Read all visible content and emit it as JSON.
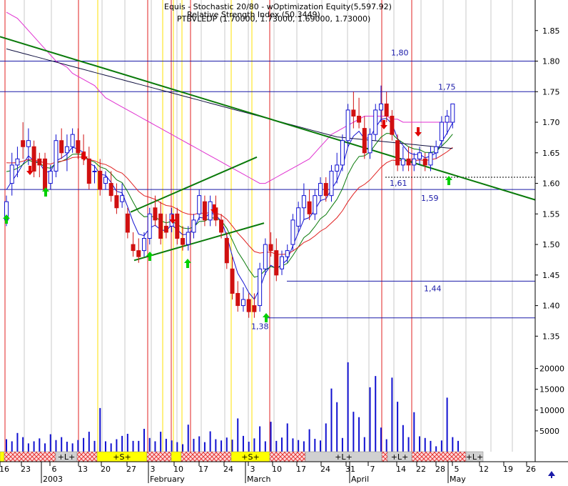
{
  "header": {
    "line1": "Equis - Stochastic 20/80 - wOptimization Equity(5,597.92)",
    "line2": "Relative Strength Index (50.3449)",
    "line3": "PTBVLEDP (1.70000, 1.73000, 1.69000, 1.73000)"
  },
  "chart_data": {
    "type": "candlestick",
    "ylim": [
      1.32,
      1.9
    ],
    "price_ticks": [
      1.35,
      1.4,
      1.45,
      1.5,
      1.55,
      1.6,
      1.65,
      1.7,
      1.75,
      1.8,
      1.85
    ],
    "price_tick_labels": [
      "1.35",
      "1.40",
      "1.45",
      "1.50",
      "1.55",
      "1.60",
      "1.65",
      "1.70",
      "1.75",
      "1.80",
      "1.85"
    ],
    "volume_ylim": [
      0,
      22000
    ],
    "volume_ticks": [
      5000,
      10000,
      15000,
      20000
    ],
    "volume_tick_labels": [
      "5000",
      "10000",
      "15000",
      "20000"
    ],
    "date_labels": [
      "16",
      "23",
      "6",
      "13",
      "20",
      "27",
      "3",
      "10",
      "17",
      "24",
      "3",
      "10",
      "17",
      "24",
      "31",
      "7",
      "14",
      "22",
      "28",
      "5",
      "12",
      "19",
      "26"
    ],
    "month_labels": [
      "2003",
      "February",
      "March",
      "April",
      "May"
    ],
    "horizontal_levels": [
      {
        "value": 1.8,
        "label": "1,80"
      },
      {
        "value": 1.75,
        "label": "1,75"
      },
      {
        "value": 1.59,
        "label": "1,59"
      },
      {
        "value": 1.44,
        "label": "1,44"
      },
      {
        "value": 1.38,
        "label": "1,38"
      }
    ],
    "dotted_level": {
      "value": 1.61,
      "label": "1,61"
    },
    "candles": [
      {
        "o": 1.54,
        "h": 1.58,
        "l": 1.53,
        "c": 1.57
      },
      {
        "o": 1.6,
        "h": 1.65,
        "l": 1.58,
        "c": 1.63
      },
      {
        "o": 1.63,
        "h": 1.66,
        "l": 1.61,
        "c": 1.64
      },
      {
        "o": 1.67,
        "h": 1.7,
        "l": 1.64,
        "c": 1.66
      },
      {
        "o": 1.66,
        "h": 1.69,
        "l": 1.63,
        "c": 1.67
      },
      {
        "o": 1.66,
        "h": 1.67,
        "l": 1.61,
        "c": 1.62
      },
      {
        "o": 1.64,
        "h": 1.65,
        "l": 1.61,
        "c": 1.63
      },
      {
        "o": 1.64,
        "h": 1.65,
        "l": 1.58,
        "c": 1.59
      },
      {
        "o": 1.6,
        "h": 1.63,
        "l": 1.59,
        "c": 1.62
      },
      {
        "o": 1.62,
        "h": 1.68,
        "l": 1.61,
        "c": 1.67
      },
      {
        "o": 1.67,
        "h": 1.69,
        "l": 1.64,
        "c": 1.65
      },
      {
        "o": 1.65,
        "h": 1.68,
        "l": 1.62,
        "c": 1.66
      },
      {
        "o": 1.66,
        "h": 1.69,
        "l": 1.65,
        "c": 1.68
      },
      {
        "o": 1.67,
        "h": 1.69,
        "l": 1.64,
        "c": 1.65
      },
      {
        "o": 1.65,
        "h": 1.68,
        "l": 1.63,
        "c": 1.64
      },
      {
        "o": 1.64,
        "h": 1.66,
        "l": 1.59,
        "c": 1.6
      },
      {
        "o": 1.62,
        "h": 1.63,
        "l": 1.6,
        "c": 1.62
      },
      {
        "o": 1.62,
        "h": 1.64,
        "l": 1.58,
        "c": 1.59
      },
      {
        "o": 1.6,
        "h": 1.62,
        "l": 1.59,
        "c": 1.61
      },
      {
        "o": 1.6,
        "h": 1.62,
        "l": 1.57,
        "c": 1.58
      },
      {
        "o": 1.58,
        "h": 1.6,
        "l": 1.55,
        "c": 1.56
      },
      {
        "o": 1.57,
        "h": 1.6,
        "l": 1.56,
        "c": 1.58
      },
      {
        "o": 1.55,
        "h": 1.56,
        "l": 1.51,
        "c": 1.52
      },
      {
        "o": 1.5,
        "h": 1.52,
        "l": 1.48,
        "c": 1.49
      },
      {
        "o": 1.49,
        "h": 1.51,
        "l": 1.47,
        "c": 1.48
      },
      {
        "o": 1.49,
        "h": 1.52,
        "l": 1.48,
        "c": 1.51
      },
      {
        "o": 1.51,
        "h": 1.56,
        "l": 1.5,
        "c": 1.55
      },
      {
        "o": 1.56,
        "h": 1.58,
        "l": 1.53,
        "c": 1.54
      },
      {
        "o": 1.55,
        "h": 1.57,
        "l": 1.5,
        "c": 1.51
      },
      {
        "o": 1.53,
        "h": 1.55,
        "l": 1.51,
        "c": 1.52
      },
      {
        "o": 1.53,
        "h": 1.56,
        "l": 1.52,
        "c": 1.55
      },
      {
        "o": 1.55,
        "h": 1.56,
        "l": 1.5,
        "c": 1.51
      },
      {
        "o": 1.51,
        "h": 1.53,
        "l": 1.49,
        "c": 1.5
      },
      {
        "o": 1.5,
        "h": 1.53,
        "l": 1.49,
        "c": 1.52
      },
      {
        "o": 1.52,
        "h": 1.55,
        "l": 1.51,
        "c": 1.54
      },
      {
        "o": 1.55,
        "h": 1.59,
        "l": 1.54,
        "c": 1.58
      },
      {
        "o": 1.57,
        "h": 1.58,
        "l": 1.53,
        "c": 1.54
      },
      {
        "o": 1.54,
        "h": 1.58,
        "l": 1.53,
        "c": 1.57
      },
      {
        "o": 1.56,
        "h": 1.58,
        "l": 1.53,
        "c": 1.54
      },
      {
        "o": 1.54,
        "h": 1.55,
        "l": 1.51,
        "c": 1.52
      },
      {
        "o": 1.51,
        "h": 1.52,
        "l": 1.46,
        "c": 1.47
      },
      {
        "o": 1.46,
        "h": 1.48,
        "l": 1.41,
        "c": 1.42
      },
      {
        "o": 1.42,
        "h": 1.44,
        "l": 1.39,
        "c": 1.4
      },
      {
        "o": 1.4,
        "h": 1.43,
        "l": 1.39,
        "c": 1.41
      },
      {
        "o": 1.41,
        "h": 1.42,
        "l": 1.38,
        "c": 1.39
      },
      {
        "o": 1.4,
        "h": 1.42,
        "l": 1.38,
        "c": 1.39
      },
      {
        "o": 1.4,
        "h": 1.47,
        "l": 1.39,
        "c": 1.46
      },
      {
        "o": 1.46,
        "h": 1.51,
        "l": 1.45,
        "c": 1.5
      },
      {
        "o": 1.5,
        "h": 1.52,
        "l": 1.48,
        "c": 1.49
      },
      {
        "o": 1.49,
        "h": 1.51,
        "l": 1.44,
        "c": 1.45
      },
      {
        "o": 1.46,
        "h": 1.49,
        "l": 1.45,
        "c": 1.48
      },
      {
        "o": 1.48,
        "h": 1.5,
        "l": 1.47,
        "c": 1.49
      },
      {
        "o": 1.5,
        "h": 1.55,
        "l": 1.49,
        "c": 1.54
      },
      {
        "o": 1.53,
        "h": 1.57,
        "l": 1.52,
        "c": 1.56
      },
      {
        "o": 1.56,
        "h": 1.6,
        "l": 1.54,
        "c": 1.58
      },
      {
        "o": 1.57,
        "h": 1.59,
        "l": 1.54,
        "c": 1.55
      },
      {
        "o": 1.55,
        "h": 1.59,
        "l": 1.54,
        "c": 1.58
      },
      {
        "o": 1.58,
        "h": 1.61,
        "l": 1.57,
        "c": 1.6
      },
      {
        "o": 1.6,
        "h": 1.61,
        "l": 1.57,
        "c": 1.58
      },
      {
        "o": 1.58,
        "h": 1.63,
        "l": 1.57,
        "c": 1.62
      },
      {
        "o": 1.62,
        "h": 1.65,
        "l": 1.6,
        "c": 1.63
      },
      {
        "o": 1.63,
        "h": 1.68,
        "l": 1.62,
        "c": 1.67
      },
      {
        "o": 1.67,
        "h": 1.73,
        "l": 1.66,
        "c": 1.72
      },
      {
        "o": 1.72,
        "h": 1.75,
        "l": 1.69,
        "c": 1.71
      },
      {
        "o": 1.71,
        "h": 1.74,
        "l": 1.69,
        "c": 1.7
      },
      {
        "o": 1.69,
        "h": 1.71,
        "l": 1.64,
        "c": 1.65
      },
      {
        "o": 1.65,
        "h": 1.69,
        "l": 1.64,
        "c": 1.68
      },
      {
        "o": 1.68,
        "h": 1.73,
        "l": 1.67,
        "c": 1.72
      },
      {
        "o": 1.72,
        "h": 1.76,
        "l": 1.7,
        "c": 1.73
      },
      {
        "o": 1.73,
        "h": 1.75,
        "l": 1.7,
        "c": 1.71
      },
      {
        "o": 1.71,
        "h": 1.72,
        "l": 1.67,
        "c": 1.68
      },
      {
        "o": 1.67,
        "h": 1.68,
        "l": 1.62,
        "c": 1.63
      },
      {
        "o": 1.63,
        "h": 1.66,
        "l": 1.62,
        "c": 1.64
      },
      {
        "o": 1.64,
        "h": 1.66,
        "l": 1.62,
        "c": 1.63
      },
      {
        "o": 1.63,
        "h": 1.65,
        "l": 1.62,
        "c": 1.64
      },
      {
        "o": 1.64,
        "h": 1.66,
        "l": 1.63,
        "c": 1.65
      },
      {
        "o": 1.64,
        "h": 1.65,
        "l": 1.62,
        "c": 1.63
      },
      {
        "o": 1.63,
        "h": 1.66,
        "l": 1.62,
        "c": 1.65
      },
      {
        "o": 1.65,
        "h": 1.67,
        "l": 1.64,
        "c": 1.66
      },
      {
        "o": 1.67,
        "h": 1.71,
        "l": 1.66,
        "c": 1.7
      },
      {
        "o": 1.7,
        "h": 1.72,
        "l": 1.68,
        "c": 1.71
      },
      {
        "o": 1.7,
        "h": 1.73,
        "l": 1.69,
        "c": 1.73
      }
    ],
    "volume": [
      3000,
      2500,
      4500,
      3500,
      2000,
      2500,
      3200,
      2000,
      4200,
      2800,
      3500,
      2400,
      2000,
      2800,
      3300,
      4800,
      2600,
      10500,
      2500,
      2000,
      3000,
      3800,
      4300,
      2600,
      2600,
      5500,
      3300,
      2500,
      4800,
      3100,
      2700,
      2300,
      1800,
      6500,
      3100,
      3700,
      2300,
      4900,
      3000,
      2700,
      3400,
      2900,
      8000,
      3800,
      2400,
      3200,
      6100,
      2500,
      7200,
      2600,
      3400,
      6800,
      3200,
      2800,
      2500,
      5400,
      3100,
      2700,
      6800,
      15200,
      11900,
      3300,
      21500,
      9600,
      8300,
      3500,
      15500,
      18200,
      5800,
      3000,
      17800,
      12000,
      6400,
      3500,
      9500,
      3700,
      3300,
      2600,
      1300,
      2700,
      13000,
      3500,
      2600
    ],
    "moving_average_slow": [
      1.88,
      1.875,
      1.87,
      1.86,
      1.85,
      1.84,
      1.83,
      1.82,
      1.81,
      1.8,
      1.795,
      1.79,
      1.78,
      1.775,
      1.77,
      1.765,
      1.76,
      1.75,
      1.74,
      1.735,
      1.73,
      1.725,
      1.72,
      1.715,
      1.71,
      1.705,
      1.7,
      1.695,
      1.69,
      1.685,
      1.68,
      1.675,
      1.67,
      1.665,
      1.66,
      1.655,
      1.65,
      1.645,
      1.64,
      1.635,
      1.63,
      1.625,
      1.62,
      1.615,
      1.61,
      1.605,
      1.6,
      1.6,
      1.605,
      1.61,
      1.615,
      1.62,
      1.625,
      1.63,
      1.635,
      1.64,
      1.65,
      1.66,
      1.67,
      1.68,
      1.685,
      1.69,
      1.695,
      1.7,
      1.705,
      1.71,
      1.71,
      1.71,
      1.71,
      1.71,
      1.705,
      1.705,
      1.7,
      1.7,
      1.7,
      1.7,
      1.7,
      1.7,
      1.7,
      1.7,
      1.7,
      1.7
    ]
  },
  "trendlines": [
    "downtrend",
    "channel-upper",
    "channel-lower"
  ],
  "bottom_bar": {
    "segments": [
      "+L+",
      "+S+",
      "+S+",
      "+L+",
      "+L+",
      "+L+"
    ]
  },
  "colors": {
    "up_candle": "#1010d0",
    "down_candle": "#d01010",
    "red_line": "#e02020",
    "yellow_line": "#ffe000",
    "grid_blue": "#1a1aa8",
    "trend_green": "#0a7a0a"
  }
}
